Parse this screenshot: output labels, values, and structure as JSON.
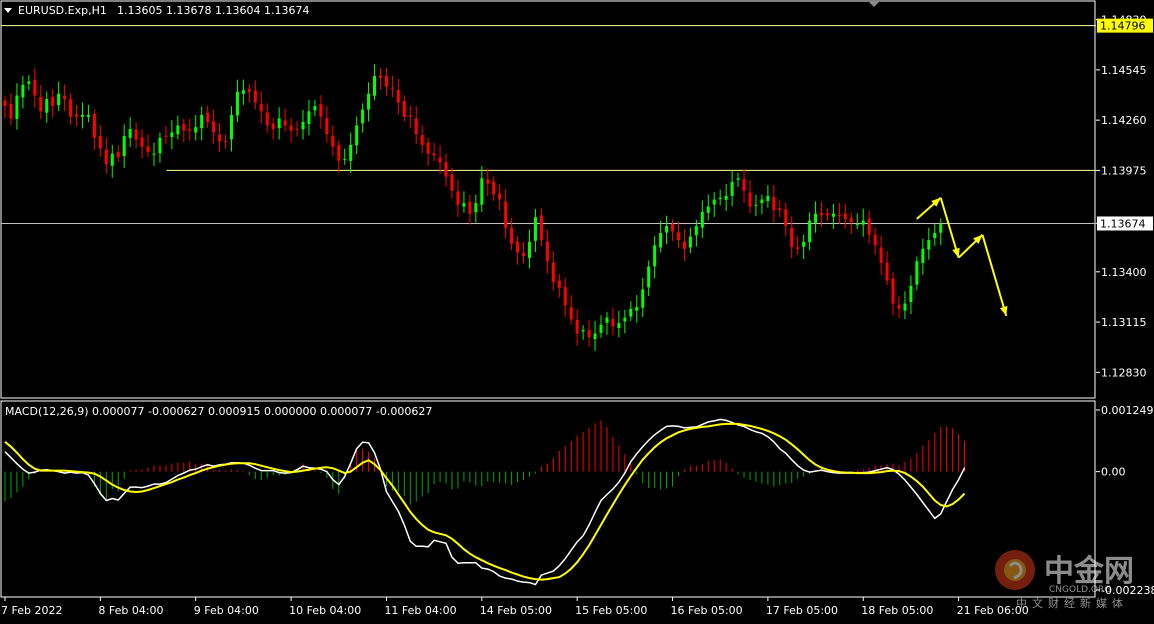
{
  "header": {
    "menu_icon": "triangle-down-icon",
    "symbol": "EURUSD.Exp,H1",
    "ohlc": "1.13605 1.13678 1.13604 1.13674"
  },
  "macd_header": "MACD(12,26,9) 0.000077 -0.000627 0.000915 0.000000 0.000077 -0.000627",
  "colors": {
    "background": "#000000",
    "frame": "#ffffff",
    "bull_candle": "#00ff00",
    "bear_candle": "#ff0000",
    "level_line": "#ffff99",
    "current_price_line": "#c0c0c0",
    "label_highlight": "#ffff00",
    "macd_line": "#ffffff",
    "signal_line": "#ffff00",
    "hist_positive": "#ff0000",
    "hist_negative": "#00aa00",
    "forecast_arrow": "#ffff00"
  },
  "watermark": {
    "logo": "cngold-logo-icon",
    "cn": "中金网",
    "en": "CNGOLD.ORG",
    "sub": "中文财经新媒体"
  },
  "chart_data": [
    {
      "type": "candlestick",
      "symbol": "EURUSD.Exp",
      "timeframe": "H1",
      "ylim": [
        1.1269,
        1.1493
      ],
      "y_ticks": [
        "1.14830",
        "1.14545",
        "1.14260",
        "1.13975",
        "1.13675",
        "1.13400",
        "1.13115",
        "1.12830"
      ],
      "price_labels": [
        {
          "text": "1.14796",
          "value": 1.14796,
          "highlight": true
        },
        {
          "text": "1.13674",
          "value": 1.13674,
          "highlight": false
        }
      ],
      "horizontal_lines": [
        {
          "value": 1.14796,
          "x_start": 0,
          "x_end": 152
        },
        {
          "value": 1.13975,
          "x_start": 12,
          "x_end": 152
        },
        {
          "value": 1.13674,
          "x_start": 0,
          "x_end": 152
        }
      ],
      "x_ticks": [
        {
          "label": "7 Feb 2022",
          "index": 0
        },
        {
          "label": "8 Feb 04:00",
          "index": 16
        },
        {
          "label": "9 Feb 04:00",
          "index": 32
        },
        {
          "label": "10 Feb 04:00",
          "index": 48
        },
        {
          "label": "11 Feb 04:00",
          "index": 64
        },
        {
          "label": "14 Feb 05:00",
          "index": 80
        },
        {
          "label": "15 Feb 05:00",
          "index": 96
        },
        {
          "label": "16 Feb 05:00",
          "index": 112
        },
        {
          "label": "17 Feb 05:00",
          "index": 128
        },
        {
          "label": "18 Feb 05:00",
          "index": 144
        },
        {
          "label": "21 Feb 06:00",
          "index": 160
        }
      ],
      "series_close": [
        1.1434,
        1.1427,
        1.144,
        1.1446,
        1.1448,
        1.144,
        1.1431,
        1.1438,
        1.1434,
        1.1441,
        1.1438,
        1.1428,
        1.1428,
        1.1429,
        1.1429,
        1.1416,
        1.141,
        1.1401,
        1.1407,
        1.1405,
        1.1417,
        1.1421,
        1.1415,
        1.1411,
        1.1408,
        1.1407,
        1.1416,
        1.1417,
        1.1419,
        1.1423,
        1.142,
        1.142,
        1.1422,
        1.1429,
        1.1425,
        1.1419,
        1.1414,
        1.1414,
        1.1429,
        1.1442,
        1.1443,
        1.1442,
        1.1436,
        1.1431,
        1.1423,
        1.1421,
        1.1427,
        1.1423,
        1.142,
        1.1421,
        1.1425,
        1.1431,
        1.1434,
        1.1428,
        1.1418,
        1.1411,
        1.1403,
        1.1404,
        1.1412,
        1.1423,
        1.1432,
        1.1441,
        1.1451,
        1.145,
        1.1445,
        1.1444,
        1.1436,
        1.1428,
        1.1428,
        1.1418,
        1.1412,
        1.1407,
        1.1406,
        1.1402,
        1.1394,
        1.1386,
        1.1378,
        1.1379,
        1.1373,
        1.1379,
        1.1393,
        1.139,
        1.1384,
        1.1381,
        1.1365,
        1.1356,
        1.1351,
        1.1349,
        1.1357,
        1.1371,
        1.1358,
        1.1346,
        1.1334,
        1.1331,
        1.1321,
        1.1313,
        1.1305,
        1.1307,
        1.1303,
        1.1305,
        1.131,
        1.1314,
        1.1309,
        1.1311,
        1.1314,
        1.1319,
        1.132,
        1.133,
        1.1343,
        1.1355,
        1.1362,
        1.1366,
        1.1363,
        1.1358,
        1.1353,
        1.136,
        1.1366,
        1.1374,
        1.1377,
        1.1381,
        1.1382,
        1.1383,
        1.1391,
        1.1393,
        1.1386,
        1.1377,
        1.1378,
        1.1381,
        1.1383,
        1.1375,
        1.1375,
        1.1366,
        1.1354,
        1.1353,
        1.1357,
        1.1369,
        1.1373,
        1.1372,
        1.1372,
        1.1373,
        1.1372,
        1.137,
        1.1368,
        1.1367,
        1.1369,
        1.1361,
        1.1355,
        1.1345,
        1.1335,
        1.1322,
        1.1319,
        1.1322,
        1.1332,
        1.1346,
        1.1353,
        1.1358,
        1.1362,
        1.1367
      ],
      "forecast_path": [
        {
          "index": 153,
          "value": 1.137
        },
        {
          "index": 157,
          "value": 1.1382
        },
        {
          "index": 160,
          "value": 1.1348
        },
        {
          "index": 164,
          "value": 1.1361
        },
        {
          "index": 168,
          "value": 1.1315
        }
      ]
    },
    {
      "type": "macd",
      "params": "12,26,9",
      "ylim": [
        -0.0025,
        0.0014
      ],
      "y_ticks": [
        "0.001249",
        "0.00",
        "-0.002238"
      ],
      "macd_line": [
        0.0004,
        0.00028,
        0.00016,
        5e-05,
        -3e-05,
        -1e-05,
        3e-05,
        4e-05,
        2e-05,
        -0.0,
        -3e-05,
        -1e-05,
        -3e-05,
        -2e-05,
        -7e-05,
        -0.00024,
        -0.00044,
        -0.00058,
        -0.00054,
        -0.00057,
        -0.00044,
        -0.00031,
        -0.00031,
        -0.00032,
        -0.00029,
        -0.00025,
        -0.00025,
        -0.00022,
        -0.00015,
        -8e-05,
        -3e-05,
        3e-05,
        5e-05,
        0.0001,
        0.00014,
        0.00011,
        0.00014,
        0.00015,
        0.00018,
        0.00018,
        0.00017,
        0.00013,
        7e-05,
        2e-05,
        2e-05,
        2e-05,
        -2e-05,
        -3e-05,
        -2e-05,
        4e-05,
        0.00011,
        8e-05,
        7e-05,
        5e-05,
        -0.0,
        -0.00016,
        -0.00026,
        -0.0001,
        0.00017,
        0.00046,
        0.00059,
        0.00058,
        0.00038,
        5e-05,
        -0.0004,
        -0.0006,
        -0.0008,
        -0.00107,
        -0.0014,
        -0.0015,
        -0.0015,
        -0.00151,
        -0.00138,
        -0.00141,
        -0.00144,
        -0.00172,
        -0.00184,
        -0.00183,
        -0.00183,
        -0.00183,
        -0.00194,
        -0.00196,
        -0.00201,
        -0.0021,
        -0.00214,
        -0.00216,
        -0.0022,
        -0.00222,
        -0.00223,
        -0.00227,
        -0.00208,
        -0.00204,
        -0.002,
        -0.00189,
        -0.00175,
        -0.00158,
        -0.00141,
        -0.00129,
        -0.00107,
        -0.00082,
        -0.00058,
        -0.00046,
        -0.00035,
        -0.00021,
        -3e-05,
        0.0002,
        0.00036,
        0.0005,
        0.00063,
        0.00074,
        0.00083,
        0.00091,
        0.00092,
        0.00091,
        0.00088,
        0.00089,
        0.0009,
        0.00095,
        0.001,
        0.00102,
        0.00105,
        0.00103,
        0.00099,
        0.00094,
        0.00091,
        0.00085,
        0.0008,
        0.00077,
        0.0007,
        0.0006,
        0.00046,
        0.00037,
        0.00024,
        0.00012,
        3e-05,
        -1e-05,
        1e-05,
        3e-05,
        0.0,
        -2e-05,
        -3e-05,
        -3e-05,
        -3e-05,
        -2e-05,
        -2e-05,
        -1e-05,
        2e-05,
        5e-05,
        8e-05,
        4e-05,
        -5e-05,
        -0.00017,
        -0.00031,
        -0.00046,
        -0.00062,
        -0.00078,
        -0.00094,
        -0.00085,
        -0.0006,
        -0.00036,
        -0.00016,
        8e-05
      ],
      "signal_line": [
        0.0006,
        0.0005,
        0.00038,
        0.00025,
        0.00014,
        6e-05,
        2e-05,
        2e-05,
        2e-05,
        2e-05,
        2e-05,
        1e-05,
        0.0,
        -1e-05,
        -2e-05,
        -4e-05,
        -0.0001,
        -0.00018,
        -0.00026,
        -0.00032,
        -0.00037,
        -0.0004,
        -0.00041,
        -0.0004,
        -0.00037,
        -0.00033,
        -0.00029,
        -0.00025,
        -0.00021,
        -0.00016,
        -0.00012,
        -7e-05,
        -3e-05,
        2e-05,
        6e-05,
        9e-05,
        0.00012,
        0.00014,
        0.00016,
        0.00017,
        0.00017,
        0.00017,
        0.00015,
        0.00012,
        9e-05,
        6e-05,
        3e-05,
        1e-05,
        -1e-05,
        -0.0,
        2e-05,
        4e-05,
        6e-05,
        8e-05,
        9e-05,
        7e-05,
        2e-05,
        -3e-05,
        0.0,
        9e-05,
        0.00018,
        0.00023,
        0.00015,
        3e-05,
        -0.00013,
        -0.00028,
        -0.00046,
        -0.00063,
        -0.00081,
        -0.00095,
        -0.00107,
        -0.00117,
        -0.00122,
        -0.00125,
        -0.00128,
        -0.00135,
        -0.00145,
        -0.00156,
        -0.00165,
        -0.00172,
        -0.00178,
        -0.00184,
        -0.00189,
        -0.00194,
        -0.00198,
        -0.00203,
        -0.00207,
        -0.00211,
        -0.00214,
        -0.00216,
        -0.00217,
        -0.00216,
        -0.00214,
        -0.00212,
        -0.00205,
        -0.00195,
        -0.00182,
        -0.00166,
        -0.00148,
        -0.00128,
        -0.00107,
        -0.00086,
        -0.00066,
        -0.00046,
        -0.00027,
        -9e-05,
        8e-05,
        0.00024,
        0.00037,
        0.00049,
        0.00059,
        0.00067,
        0.00073,
        0.00079,
        0.00083,
        0.00086,
        0.00088,
        0.0009,
        0.00091,
        0.00093,
        0.00095,
        0.00096,
        0.00096,
        0.00096,
        0.00094,
        0.00092,
        0.00089,
        0.00086,
        0.00082,
        0.00077,
        0.00071,
        0.00064,
        0.00055,
        0.00045,
        0.00034,
        0.00023,
        0.00014,
        8e-05,
        4e-05,
        1e-05,
        -1e-05,
        -2e-05,
        -2e-05,
        -3e-05,
        -3e-05,
        -3e-05,
        -2e-05,
        -1e-05,
        1e-05,
        2e-05,
        1e-05,
        -3e-05,
        -0.0001,
        -0.00019,
        -0.0003,
        -0.00044,
        -0.00058,
        -0.00067,
        -0.0007,
        -0.00065,
        -0.00056,
        -0.00044
      ],
      "histogram": [
        -0.0006,
        -0.00053,
        -0.00042,
        -0.0003,
        -0.00016,
        -5e-05,
        3e-05,
        4e-05,
        1e-05,
        -2e-05,
        -5e-05,
        -3e-05,
        -5e-05,
        -3e-05,
        -9e-05,
        -0.0003,
        -0.00048,
        -0.00055,
        -0.00035,
        -0.0004,
        -0.00014,
        3e-05,
        4e-05,
        5e-05,
        8e-05,
        0.00012,
        0.00012,
        0.00012,
        0.00016,
        0.00018,
        0.00018,
        0.0002,
        0.00016,
        0.00016,
        0.00015,
        4e-05,
        4e-05,
        2e-05,
        4e-05,
        3e-05,
        2e-05,
        -7e-05,
        -0.00015,
        -0.00017,
        -0.00012,
        -7e-05,
        -8e-05,
        -7e-05,
        -4e-05,
        6e-05,
        0.00016,
        6e-05,
        3e-05,
        -3e-05,
        -0.00013,
        -0.00035,
        -0.00045,
        -0.00014,
        0.00018,
        0.00043,
        0.00046,
        0.00039,
        0.00027,
        5e-05,
        -0.00031,
        -0.00038,
        -0.0004,
        -0.00049,
        -0.00066,
        -0.0006,
        -0.0005,
        -0.00043,
        -0.00025,
        -0.00021,
        -0.00024,
        -0.00036,
        -0.00034,
        -0.0002,
        -0.00022,
        -0.00028,
        -0.00029,
        -0.0002,
        -0.00021,
        -0.00022,
        -0.00024,
        -0.00027,
        -0.00021,
        -0.00017,
        -0.0001,
        -4e-05,
        0.0001,
        0.00016,
        0.00027,
        0.00042,
        0.00052,
        0.00061,
        0.00073,
        0.0008,
        0.00088,
        0.00097,
        0.00103,
        0.0009,
        0.0007,
        0.00053,
        0.00035,
        0.00015,
        -5e-05,
        -0.00023,
        -0.00033,
        -0.00033,
        -0.00036,
        -0.00034,
        -0.0003,
        -9e-05,
        5e-05,
        0.00011,
        0.00012,
        0.00015,
        0.00021,
        0.00023,
        0.00025,
        0.00017,
        6e-05,
        -5e-05,
        -0.00012,
        -0.00017,
        -0.0002,
        -0.00024,
        -0.00026,
        -0.0003,
        -0.00027,
        -0.00024,
        -0.00023,
        -0.00014,
        -0.0001,
        -5e-05,
        2e-05,
        5e-05,
        3e-05,
        3e-05,
        2e-05,
        -1e-05,
        -2e-05,
        3e-05,
        5e-05,
        8e-05,
        0.00012,
        0.00013,
        0.00015,
        0.00016,
        0.00013,
        0.0002,
        0.00026,
        0.00038,
        0.00052,
        0.00063,
        0.00078,
        0.0009,
        0.00091,
        0.00087,
        0.00076,
        0.00062
      ]
    }
  ]
}
